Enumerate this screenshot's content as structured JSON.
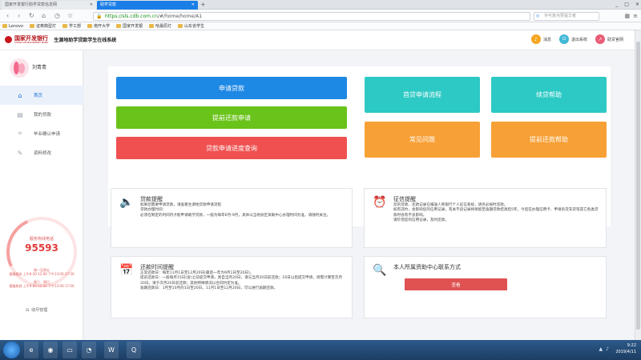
{
  "browser": {
    "tabs": [
      {
        "label": "国家开发银行助学贷款信息网",
        "active": false
      },
      {
        "label": "助学贷款",
        "active": true
      }
    ],
    "new_tab": "+",
    "window_controls": [
      "_",
      "□",
      "✕"
    ],
    "url_scheme": "https://",
    "url_host": "sls.cdb.com.cn",
    "url_path": "/#/home/home/A1",
    "search_placeholder": "许可复点赞提华者",
    "bookmarks": [
      "Lenovo",
      "证奥典型灯",
      "学工部",
      "南开大学",
      "国家开发银",
      "哈最原灯",
      "山东省学生"
    ]
  },
  "header": {
    "bank_name": "国家开发银行",
    "bank_sub": "CHINA DEVELOPMENT BANK",
    "system_title": "生源地助学贷款学生在线系统",
    "actions": [
      {
        "label": "消息",
        "icon": "bell-icon",
        "color": "#f5a623"
      },
      {
        "label": "退出系统",
        "icon": "logout-icon",
        "color": "#3fb8d6"
      },
      {
        "label": "助贷官网",
        "icon": "external-link-icon",
        "color": "#e85d75"
      }
    ]
  },
  "sidebar": {
    "username": "刘青青",
    "items": [
      {
        "label": "首页",
        "icon": "home-icon",
        "active": true
      },
      {
        "label": "我的贷款",
        "icon": "document-icon",
        "active": false
      },
      {
        "label": "毕业确认申请",
        "icon": "tag-icon",
        "active": false
      },
      {
        "label": "资料修改",
        "icon": "edit-icon",
        "active": false
      }
    ],
    "hotline_label": "服务热线电话",
    "hotline_number": "95593",
    "hours": [
      "周一至周五",
      "客服服务 上午8:30-12:00 下午13:00-17:30",
      "周六、周日",
      "客服热线 上午9:00-12:00 下午13:00-17:00"
    ],
    "collapse_label": "收尽管理"
  },
  "actions": {
    "apply_loan": "申请贷款",
    "early_repay": "提前还款申请",
    "progress_query": "贷款申请进度查询",
    "first_loan_flow": "首贷申请流程",
    "continue_help": "续贷帮助",
    "faq": "常见问题",
    "early_repay_help": "提前还款帮助"
  },
  "colors": {
    "blue": "#1e88e5",
    "green": "#6ac31a",
    "red": "#f05050",
    "teal": "#2dc9c4",
    "orange": "#f7a035"
  },
  "cards": {
    "loan_reminder": {
      "title": "贷款提醒",
      "lines": [
        "如果您需要申请贷款，请查看生源地贷款申请流程",
        "贷款办理时间：",
        "必须在制定的时间内才能申请助学贷款，一般为每年6月-9月，具体以当地县区资助中心办理时间为准，请随时关注。"
      ]
    },
    "credit_reminder": {
      "title": "征信提醒",
      "lines": [
        "您的贷款、还款记录已报送人民银行个人征信系统，请务必按时还款。",
        "如有违约，会影响您的信用记录，有关不良记录将保留至逾期贷款结清后5年，今后在办理信用卡、申请房贷车贷等其它各类贷款时会有不良影响。",
        "请珍惜您的信用记录，及时还款。"
      ]
    },
    "repay_time": {
      "title": "还款时间提醒",
      "lines": [
        "正常还款日：每年11月1日至12月20日(最后一年为9月1日至20日)。",
        "提前还款日：一般每月15日(含)之前提交申请，则自当月20日，请与当月20日前还款；16日以后提交申请，则需计算至次月20日，请于次月20日前还款；其他特殊情况以合同约定为准。",
        "逾期还款日：1月至10月的1日至20日，11月1日至12月20日，可以进行逾期还款。"
      ]
    },
    "contact": {
      "title": "本人所属资助中心联系方式",
      "button": "查看"
    }
  },
  "taskbar": {
    "time": "9:22",
    "date": "2019/4/11"
  }
}
